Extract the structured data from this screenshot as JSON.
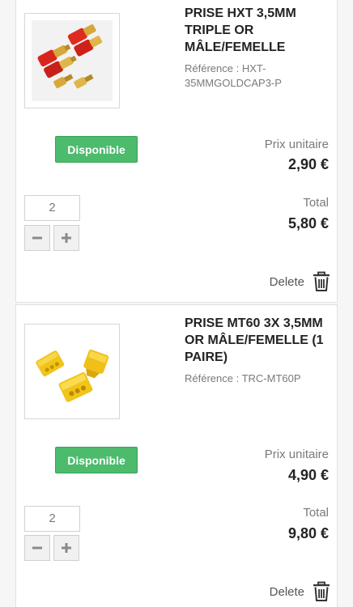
{
  "items": [
    {
      "title": "PRISE HXT 3,5MM TRIPLE OR MÂLE/FEMELLE",
      "reference": "Référence : HXT-35MMGOLDCAP3-P",
      "status": "Disponible",
      "unit_price_label": "Prix unitaire",
      "unit_price": "2,90 €",
      "total_label": "Total",
      "total": "5,80 €",
      "quantity": "2",
      "delete_label": "Delete",
      "product_image": "red-gold-bullet-connectors"
    },
    {
      "title": "PRISE MT60 3X 3,5MM OR MÂLE/FEMELLE (1 PAIRE)",
      "reference": "Référence : TRC-MT60P",
      "status": "Disponible",
      "unit_price_label": "Prix unitaire",
      "unit_price": "4,90 €",
      "total_label": "Total",
      "total": "9,80 €",
      "quantity": "2",
      "delete_label": "Delete",
      "product_image": "yellow-mt60-connectors"
    }
  ],
  "colors": {
    "available_badge": "#4cbb6c",
    "text": "#232323",
    "muted": "#7a7a7a"
  },
  "icons": {
    "minus": "minus-icon",
    "plus": "plus-icon",
    "delete": "trash-icon"
  }
}
